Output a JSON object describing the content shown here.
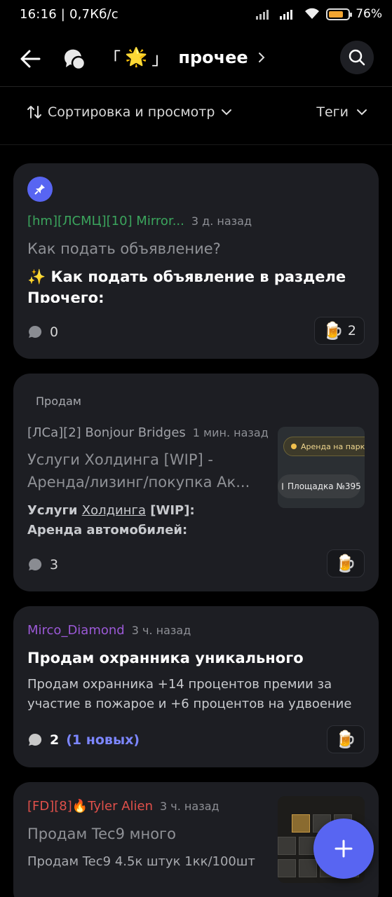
{
  "status_bar": {
    "time": "16:16",
    "speed": "0,7Кб/с",
    "battery": "76",
    "battery_level": 0.76
  },
  "header": {
    "left_bracket": "「",
    "right_bracket": "」",
    "star": "🌟",
    "title": "прочее"
  },
  "sortbar": {
    "sort_label": "Сортировка и просмотр",
    "tags_label": "Теги"
  },
  "posts": [
    {
      "author": "[hm][ЛСМЦ][10] Mirror...",
      "author_color": "#3ba55d",
      "time": "3 д. назад",
      "title": "Как подать объявление?",
      "excerpt_emoji": "✨",
      "excerpt": "Как подать объявление в разделе Прочего:",
      "comments": "0",
      "reactions": "2"
    },
    {
      "tag": "Продам",
      "author": "[ЛСа][2] Bonjour Bridges",
      "author_color": "#a0a2a8",
      "time": "1 мин. назад",
      "title": "Услуги Холдинга [WIP] - Аренда/лизинг/покупка Ак...",
      "excerpt_a": "Услуги ",
      "excerpt_link": "Холдинга",
      "excerpt_b": " [WIP]:",
      "excerpt_line2": "Аренда  автомобилей:",
      "comments": "3",
      "thumb_pill1": "Аренда на парковке",
      "thumb_pill2": "Площадка №395"
    },
    {
      "author": "Mirco_Diamond",
      "author_color": "#9b59d6",
      "time": "3 ч. назад",
      "title": "Продам охранника уникального",
      "excerpt": "Продам охранника +14 процентов премии за участие в пожарое и +6 процентов на удвоение ...",
      "comments": "2",
      "new_count": "(1 новых)"
    },
    {
      "author_prefix": "[FD][8]",
      "author_emoji": "🔥",
      "author_name": "Tyler Alien",
      "author_color": "#e0504a",
      "time": "3 ч. назад",
      "title": "Продам Tec9 много",
      "excerpt": "Продам Tec9 4.5к штук 1кк/100шт"
    }
  ],
  "colors": {
    "accent": "#5865f2",
    "card_bg": "#1d1e23",
    "background": "#000000"
  }
}
